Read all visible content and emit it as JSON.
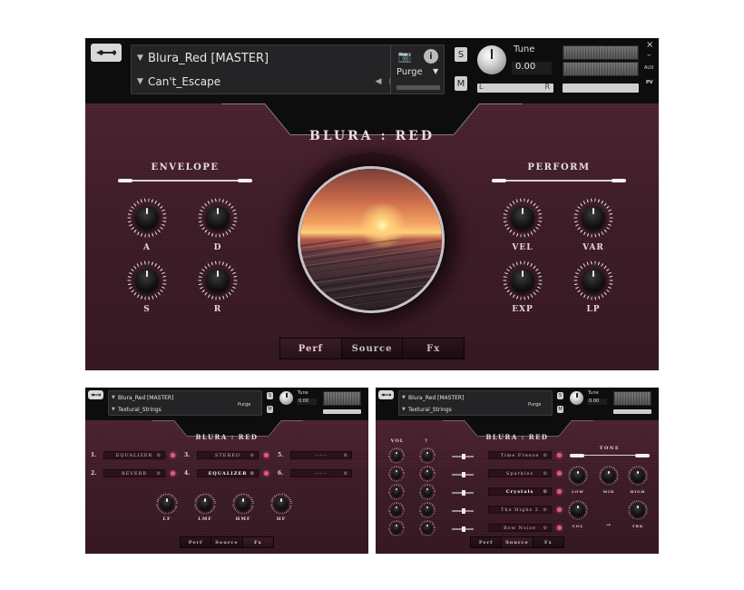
{
  "colors": {
    "accent": "#e85a78",
    "panel_bg": "#3d1b27",
    "header_bg": "#0d0d0e"
  },
  "main": {
    "instrument_name": "Blura_Red [MASTER]",
    "preset_name": "Can't_Escape",
    "purge_label": "Purge",
    "solo_label": "S",
    "mute_label": "M",
    "tune_label": "Tune",
    "tune_value": "0.00",
    "pan_left": "L",
    "pan_right": "R",
    "aux_label": "AUX",
    "pv_label": "PV",
    "close_label": "×",
    "minimize_label": "–",
    "title": "BLURA : RED",
    "envelope_title": "ENVELOPE",
    "perform_title": "PERFORM",
    "envelope_knobs": [
      "A",
      "D",
      "S",
      "R"
    ],
    "perform_knobs": [
      "VEL",
      "VAR",
      "EXP",
      "LP"
    ],
    "tabs": [
      {
        "label": "Perf",
        "active": true
      },
      {
        "label": "Source",
        "active": false
      },
      {
        "label": "Fx",
        "active": false
      }
    ],
    "icons": [
      "wrench-icon",
      "camera-icon",
      "info-icon",
      "save-icon",
      "trash-icon"
    ]
  },
  "fx_panel": {
    "instrument_name": "Blura_Red [MASTER]",
    "preset_name": "Textural_Strings",
    "purge_label": "Purge",
    "tune_label": "Tune",
    "tune_value": "0.00",
    "title": "BLURA : RED",
    "rows": [
      [
        {
          "num": "1.",
          "label": "EQUALIZER",
          "on": false
        },
        {
          "num": "3.",
          "label": "STEREO",
          "on": false
        },
        {
          "num": "5.",
          "label": "-----",
          "on": false
        }
      ],
      [
        {
          "num": "2.",
          "label": "REVERB",
          "on": false
        },
        {
          "num": "4.",
          "label": "EQUALIZER",
          "on": true
        },
        {
          "num": "6.",
          "label": "-----",
          "on": false
        }
      ]
    ],
    "knobs": [
      "LF",
      "LMF",
      "HMF",
      "HF"
    ],
    "tabs": [
      {
        "label": "Perf",
        "active": false
      },
      {
        "label": "Source",
        "active": false
      },
      {
        "label": "Fx",
        "active": true
      }
    ]
  },
  "source_panel": {
    "instrument_name": "Blura_Red [MASTER]",
    "preset_name": "Textural_Strings",
    "purge_label": "Purge",
    "tune_label": "Tune",
    "tune_value": "0.00",
    "title": "BLURA : RED",
    "vol_label": "VOL",
    "pan_label": "?",
    "layers": [
      "Time Freeze",
      "Sparkles",
      "Crystals",
      "The Highs 2",
      "Bow Noise"
    ],
    "active_layer": "Crystals",
    "tone_title": "TONE",
    "tone_knobs": [
      "LOW",
      "MID",
      "HIGH"
    ],
    "tone_knobs_bottom": [
      "COL",
      "→",
      "TRK"
    ],
    "tabs": [
      {
        "label": "Perf",
        "active": false
      },
      {
        "label": "Source",
        "active": true
      },
      {
        "label": "Fx",
        "active": false
      }
    ]
  }
}
